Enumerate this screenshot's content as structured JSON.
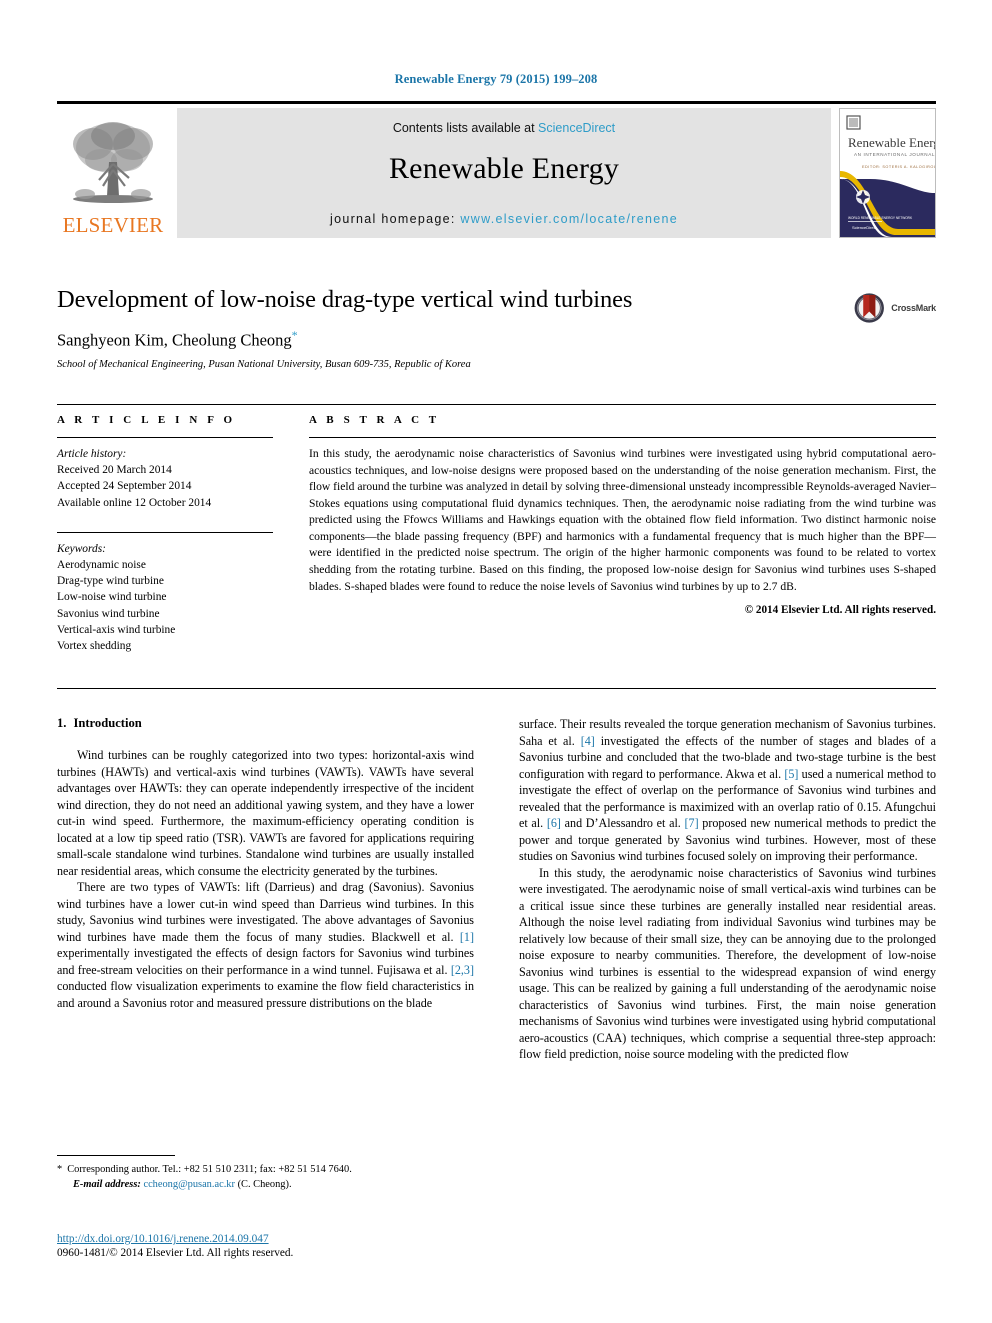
{
  "running_head": "Renewable Energy 79 (2015) 199–208",
  "masthead": {
    "publisher_name": "ELSEVIER",
    "contents_prefix": "Contents lists available at ",
    "contents_link": "ScienceDirect",
    "journal_name": "Renewable Energy",
    "homepage_prefix": "journal homepage: ",
    "homepage_url": "www.elsevier.com/locate/renene",
    "cover": {
      "title": "Renewable Energy",
      "subtitle": "AN INTERNATIONAL JOURNAL",
      "tagline": "EDITOR: SOTERIS A. KALOGIROU"
    }
  },
  "article": {
    "title": "Development of low-noise drag-type vertical wind turbines",
    "authors": "Sanghyeon Kim, Cheolung Cheong",
    "corresponding_marker": "*",
    "affiliation": "School of Mechanical Engineering, Pusan National University, Busan 609-735, Republic of Korea",
    "crossmark_label": "CrossMark"
  },
  "article_info": {
    "heading": "A R T I C L E   I N F O",
    "history_label": "Article history:",
    "history": [
      "Received 20 March 2014",
      "Accepted 24 September 2014",
      "Available online 12 October 2014"
    ],
    "keywords_label": "Keywords:",
    "keywords": [
      "Aerodynamic noise",
      "Drag-type wind turbine",
      "Low-noise wind turbine",
      "Savonius wind turbine",
      "Vertical-axis wind turbine",
      "Vortex shedding"
    ]
  },
  "abstract": {
    "heading": "A B S T R A C T",
    "text": "In this study, the aerodynamic noise characteristics of Savonius wind turbines were investigated using hybrid computational aero-acoustics techniques, and low-noise designs were proposed based on the understanding of the noise generation mechanism. First, the flow field around the turbine was analyzed in detail by solving three-dimensional unsteady incompressible Reynolds-averaged Navier–Stokes equations using computational fluid dynamics techniques. Then, the aerodynamic noise radiating from the wind turbine was predicted using the Ffowcs Williams and Hawkings equation with the obtained flow field information. Two distinct harmonic noise components—the blade passing frequency (BPF) and harmonics with a fundamental frequency that is much higher than the BPF—were identified in the predicted noise spectrum. The origin of the higher harmonic components was found to be related to vortex shedding from the rotating turbine. Based on this finding, the proposed low-noise design for Savonius wind turbines uses S-shaped blades. S-shaped blades were found to reduce the noise levels of Savonius wind turbines by up to 2.7 dB.",
    "copyright": "© 2014 Elsevier Ltd. All rights reserved."
  },
  "body": {
    "section_number": "1.",
    "section_title": "Introduction",
    "left_paragraphs": [
      "Wind turbines can be roughly categorized into two types: horizontal-axis wind turbines (HAWTs) and vertical-axis wind turbines (VAWTs). VAWTs have several advantages over HAWTs: they can operate independently irrespective of the incident wind direction, they do not need an additional yawing system, and they have a lower cut-in wind speed. Furthermore, the maximum-efficiency operating condition is located at a low tip speed ratio (TSR). VAWTs are favored for applications requiring small-scale standalone wind turbines. Standalone wind turbines are usually installed near residential areas, which consume the electricity generated by the turbines."
    ],
    "left_paragraph2_parts": [
      {
        "t": "There are two types of VAWTs: lift (Darrieus) and drag (Savonius). Savonius wind turbines have a lower cut-in wind speed than Darrieus wind turbines. In this study, Savonius wind turbines were investigated. The above advantages of Savonius wind turbines have made them the focus of many studies. Blackwell et al. "
      },
      {
        "t": "[1]",
        "ref": true
      },
      {
        "t": " experimentally investigated the effects of design factors for Savonius wind turbines and free-stream velocities on their performance in a wind tunnel. Fujisawa et al. "
      },
      {
        "t": "[2,3]",
        "ref": true
      },
      {
        "t": " conducted flow visualization experiments to examine the flow field characteristics in and around a Savonius rotor and measured pressure distributions on the blade"
      }
    ],
    "right_paragraph1_parts": [
      {
        "t": "surface. Their results revealed the torque generation mechanism of Savonius turbines. Saha et al. "
      },
      {
        "t": "[4]",
        "ref": true
      },
      {
        "t": " investigated the effects of the number of stages and blades of a Savonius turbine and concluded that the two-blade and two-stage turbine is the best configuration with regard to performance. Akwa et al. "
      },
      {
        "t": "[5]",
        "ref": true
      },
      {
        "t": " used a numerical method to investigate the effect of overlap on the performance of Savonius wind turbines and revealed that the performance is maximized with an overlap ratio of 0.15. Afungchui et al. "
      },
      {
        "t": "[6]",
        "ref": true
      },
      {
        "t": " and D’Alessandro et al. "
      },
      {
        "t": "[7]",
        "ref": true
      },
      {
        "t": " proposed new numerical methods to predict the power and torque generated by Savonius wind turbines. However, most of these studies on Savonius wind turbines focused solely on improving their performance."
      }
    ],
    "right_paragraphs2": [
      "In this study, the aerodynamic noise characteristics of Savonius wind turbines were investigated. The aerodynamic noise of small vertical-axis wind turbines can be a critical issue since these turbines are generally installed near residential areas. Although the noise level radiating from individual Savonius wind turbines may be relatively low because of their small size, they can be annoying due to the prolonged noise exposure to nearby communities. Therefore, the development of low-noise Savonius wind turbines is essential to the widespread expansion of wind energy usage. This can be realized by gaining a full understanding of the aerodynamic noise characteristics of Savonius wind turbines. First, the main noise generation mechanisms of Savonius wind turbines were investigated using hybrid computational aero-acoustics (CAA) techniques, which comprise a sequential three-step approach: flow field prediction, noise source modeling with the predicted flow"
    ]
  },
  "footnotes": {
    "corresponding": "Corresponding author. Tel.: +82 51 510 2311; fax: +82 51 514 7640.",
    "bullet": "*",
    "email_label": "E-mail address:",
    "email": "ccheong@pusan.ac.kr",
    "email_suffix": "(C. Cheong).",
    "doi": "http://dx.doi.org/10.1016/j.renene.2014.09.047",
    "issn_line": "0960-1481/© 2014 Elsevier Ltd. All rights reserved."
  },
  "colors": {
    "link_blue": "#1b75a8",
    "sd_blue": "#2e9cc8",
    "elsevier_orange": "#e87722",
    "band_grey": "#e3e3e3",
    "cover_navy": "#2b2a5e",
    "cover_gold": "#e8b700",
    "crossmark_red": "#b5281e"
  }
}
